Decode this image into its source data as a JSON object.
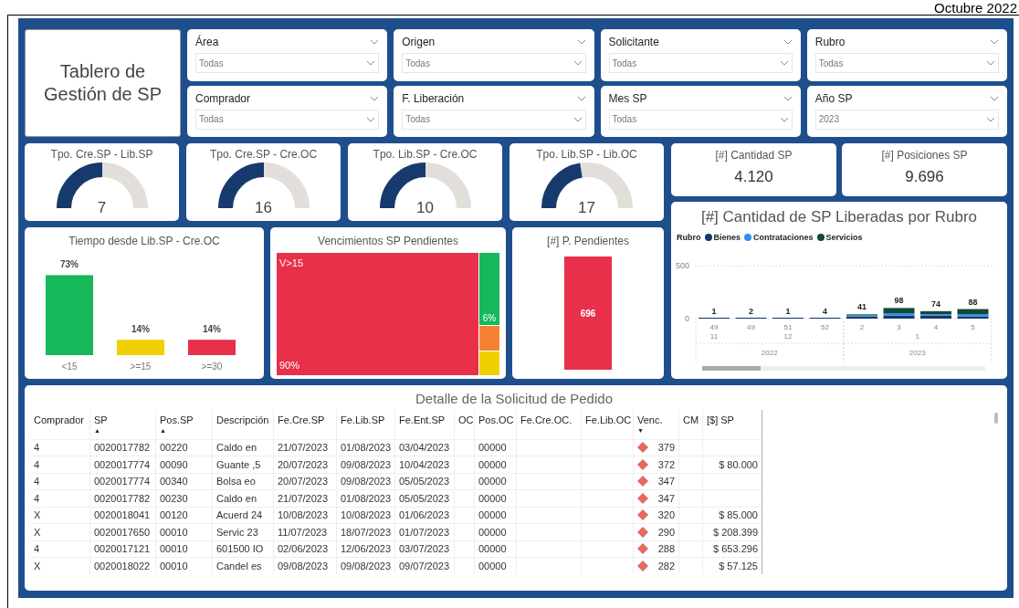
{
  "period": "Octubre 2022",
  "title": "Tablero de Gestión de SP",
  "filters": [
    {
      "label": "Área",
      "value": "Todas"
    },
    {
      "label": "Origen",
      "value": "Todas"
    },
    {
      "label": "Solicitante",
      "value": "Todas"
    },
    {
      "label": "Rubro",
      "value": "Todas"
    },
    {
      "label": "Comprador",
      "value": "Todas"
    },
    {
      "label": "F. Liberación",
      "value": "Todas"
    },
    {
      "label": "Mes SP",
      "value": "Todas"
    },
    {
      "label": "Año SP",
      "value": "2023"
    }
  ],
  "gauges": [
    {
      "title": "Tpo. Cre.SP - Lib.SP",
      "value": "7",
      "level": 0.5
    },
    {
      "title": "Tpo. Cre.SP - Cre.OC",
      "value": "16",
      "level": 0.5
    },
    {
      "title": "Tpo. Lib.SP - Cre.OC",
      "value": "10",
      "level": 0.5
    },
    {
      "title": "Tpo. Lib.SP - Lib.OC",
      "value": "17",
      "level": 0.45
    }
  ],
  "kpis": [
    {
      "title": "[#] Cantidad SP",
      "value": "4.120"
    },
    {
      "title": "[#] Posiciones SP",
      "value": "9.696"
    }
  ],
  "tiempo": {
    "title": "Tiempo desde Lib.SP - Cre.OC",
    "bars": [
      {
        "color": "#16b85a"
      },
      {
        "color": "#f0d000"
      },
      {
        "color": "#e8304a"
      }
    ],
    "chart_data": {
      "type": "bar",
      "categories": [
        "<15",
        ">=15",
        ">=30"
      ],
      "values": [
        73,
        14,
        14
      ],
      "value_labels": [
        "73%",
        "14%",
        "14%"
      ]
    }
  },
  "vencimientos": {
    "title": "Vencimientos SP Pendientes",
    "tiles": [
      {
        "label": "V>15",
        "value_label": "90%",
        "color": "#e8304a"
      },
      {
        "value_label": "6%",
        "color": "#16b85a"
      },
      {
        "color": "#f58232"
      },
      {
        "color": "#f0d000"
      }
    ]
  },
  "pendientes": {
    "title": "[#] P. Pendientes",
    "value": "696",
    "color": "#e8304a"
  },
  "rubro_chart": {
    "title": "[#] Cantidad de SP Liberadas por Rubro",
    "legend_title": "Rubro",
    "month_labels": [
      "11",
      "12",
      "1"
    ],
    "year_labels": [
      "2022",
      "2023"
    ],
    "chart_data": {
      "type": "bar",
      "stacked": true,
      "ylim": [
        0,
        500
      ],
      "yticks": [
        0,
        500
      ],
      "categories": [
        "49",
        "49",
        "51",
        "52",
        "2",
        "3",
        "4",
        "5"
      ],
      "series": [
        {
          "name": "Bienes",
          "color": "#12386e",
          "values": [
            0,
            0,
            0,
            0,
            20,
            30,
            30,
            20
          ]
        },
        {
          "name": "Contrataciones",
          "color": "#2f8cf0",
          "values": [
            0,
            0,
            0,
            0,
            10,
            20,
            10,
            20
          ]
        },
        {
          "name": "Servicios",
          "color": "#0f4a3a",
          "values": [
            0,
            0,
            0,
            0,
            10,
            50,
            30,
            50
          ]
        }
      ],
      "value_labels": [
        "1",
        "2",
        "1",
        "4",
        "41",
        "98",
        "74",
        "88"
      ]
    }
  },
  "table": {
    "title": "Detalle de la Solicitud de Pedido",
    "columns": [
      {
        "label": "Comprador"
      },
      {
        "label": "SP",
        "sort_arrow": "▲"
      },
      {
        "label": "Pos.SP",
        "sort_arrow": "▲"
      },
      {
        "label": "Descripción"
      },
      {
        "label": "Fe.Cre.SP"
      },
      {
        "label": "Fe.Lib.SP"
      },
      {
        "label": "Fe.Ent.SP"
      },
      {
        "label": "OC"
      },
      {
        "label": "Pos.OC"
      },
      {
        "label": "Fe.Cre.OC."
      },
      {
        "label": "Fe.Lib.OC"
      },
      {
        "label": "Venc.",
        "sort_arrow": "▼",
        "kind": "indicator"
      },
      {
        "label": "CM"
      },
      {
        "label": "[$] SP",
        "kind": "money"
      }
    ],
    "rows": [
      [
        "4",
        "0020017782",
        "00220",
        "Caldo  en",
        "21/07/2023",
        "01/08/2023",
        "03/04/2023",
        null,
        "00000",
        null,
        null,
        "379",
        null,
        null
      ],
      [
        "4",
        "0020017774",
        "00090",
        "Guante ,5",
        "20/07/2023",
        "09/08/2023",
        "10/04/2023",
        null,
        "00000",
        null,
        null,
        "372",
        null,
        "$ 80.000"
      ],
      [
        "4",
        "0020017774",
        "00340",
        "Bolsa  eo",
        "20/07/2023",
        "09/08/2023",
        "05/05/2023",
        null,
        "00000",
        null,
        null,
        "347",
        null,
        null
      ],
      [
        "4",
        "0020017782",
        "00230",
        "Caldo  en",
        "21/07/2023",
        "01/08/2023",
        "05/05/2023",
        null,
        "00000",
        null,
        null,
        "347",
        null,
        null
      ],
      [
        "X",
        "0020018041",
        "00120",
        "Acuerd 24",
        "10/08/2023",
        "10/08/2023",
        "01/06/2023",
        null,
        "00000",
        null,
        null,
        "320",
        null,
        "$ 85.000"
      ],
      [
        "X",
        "0020017650",
        "00010",
        "Servic 23",
        "11/07/2023",
        "18/07/2023",
        "01/07/2023",
        null,
        "00000",
        null,
        null,
        "290",
        null,
        "$ 208.399"
      ],
      [
        "4",
        "0020017121",
        "00010",
        "601500 IO",
        "02/06/2023",
        "12/06/2023",
        "03/07/2023",
        null,
        "00000",
        null,
        null,
        "288",
        null,
        "$ 653.296"
      ],
      [
        "X",
        "0020018022",
        "00010",
        "Candel es",
        "09/08/2023",
        "09/08/2023",
        "09/07/2023",
        null,
        "00000",
        null,
        null,
        "282",
        null,
        "$ 57.125"
      ]
    ]
  }
}
